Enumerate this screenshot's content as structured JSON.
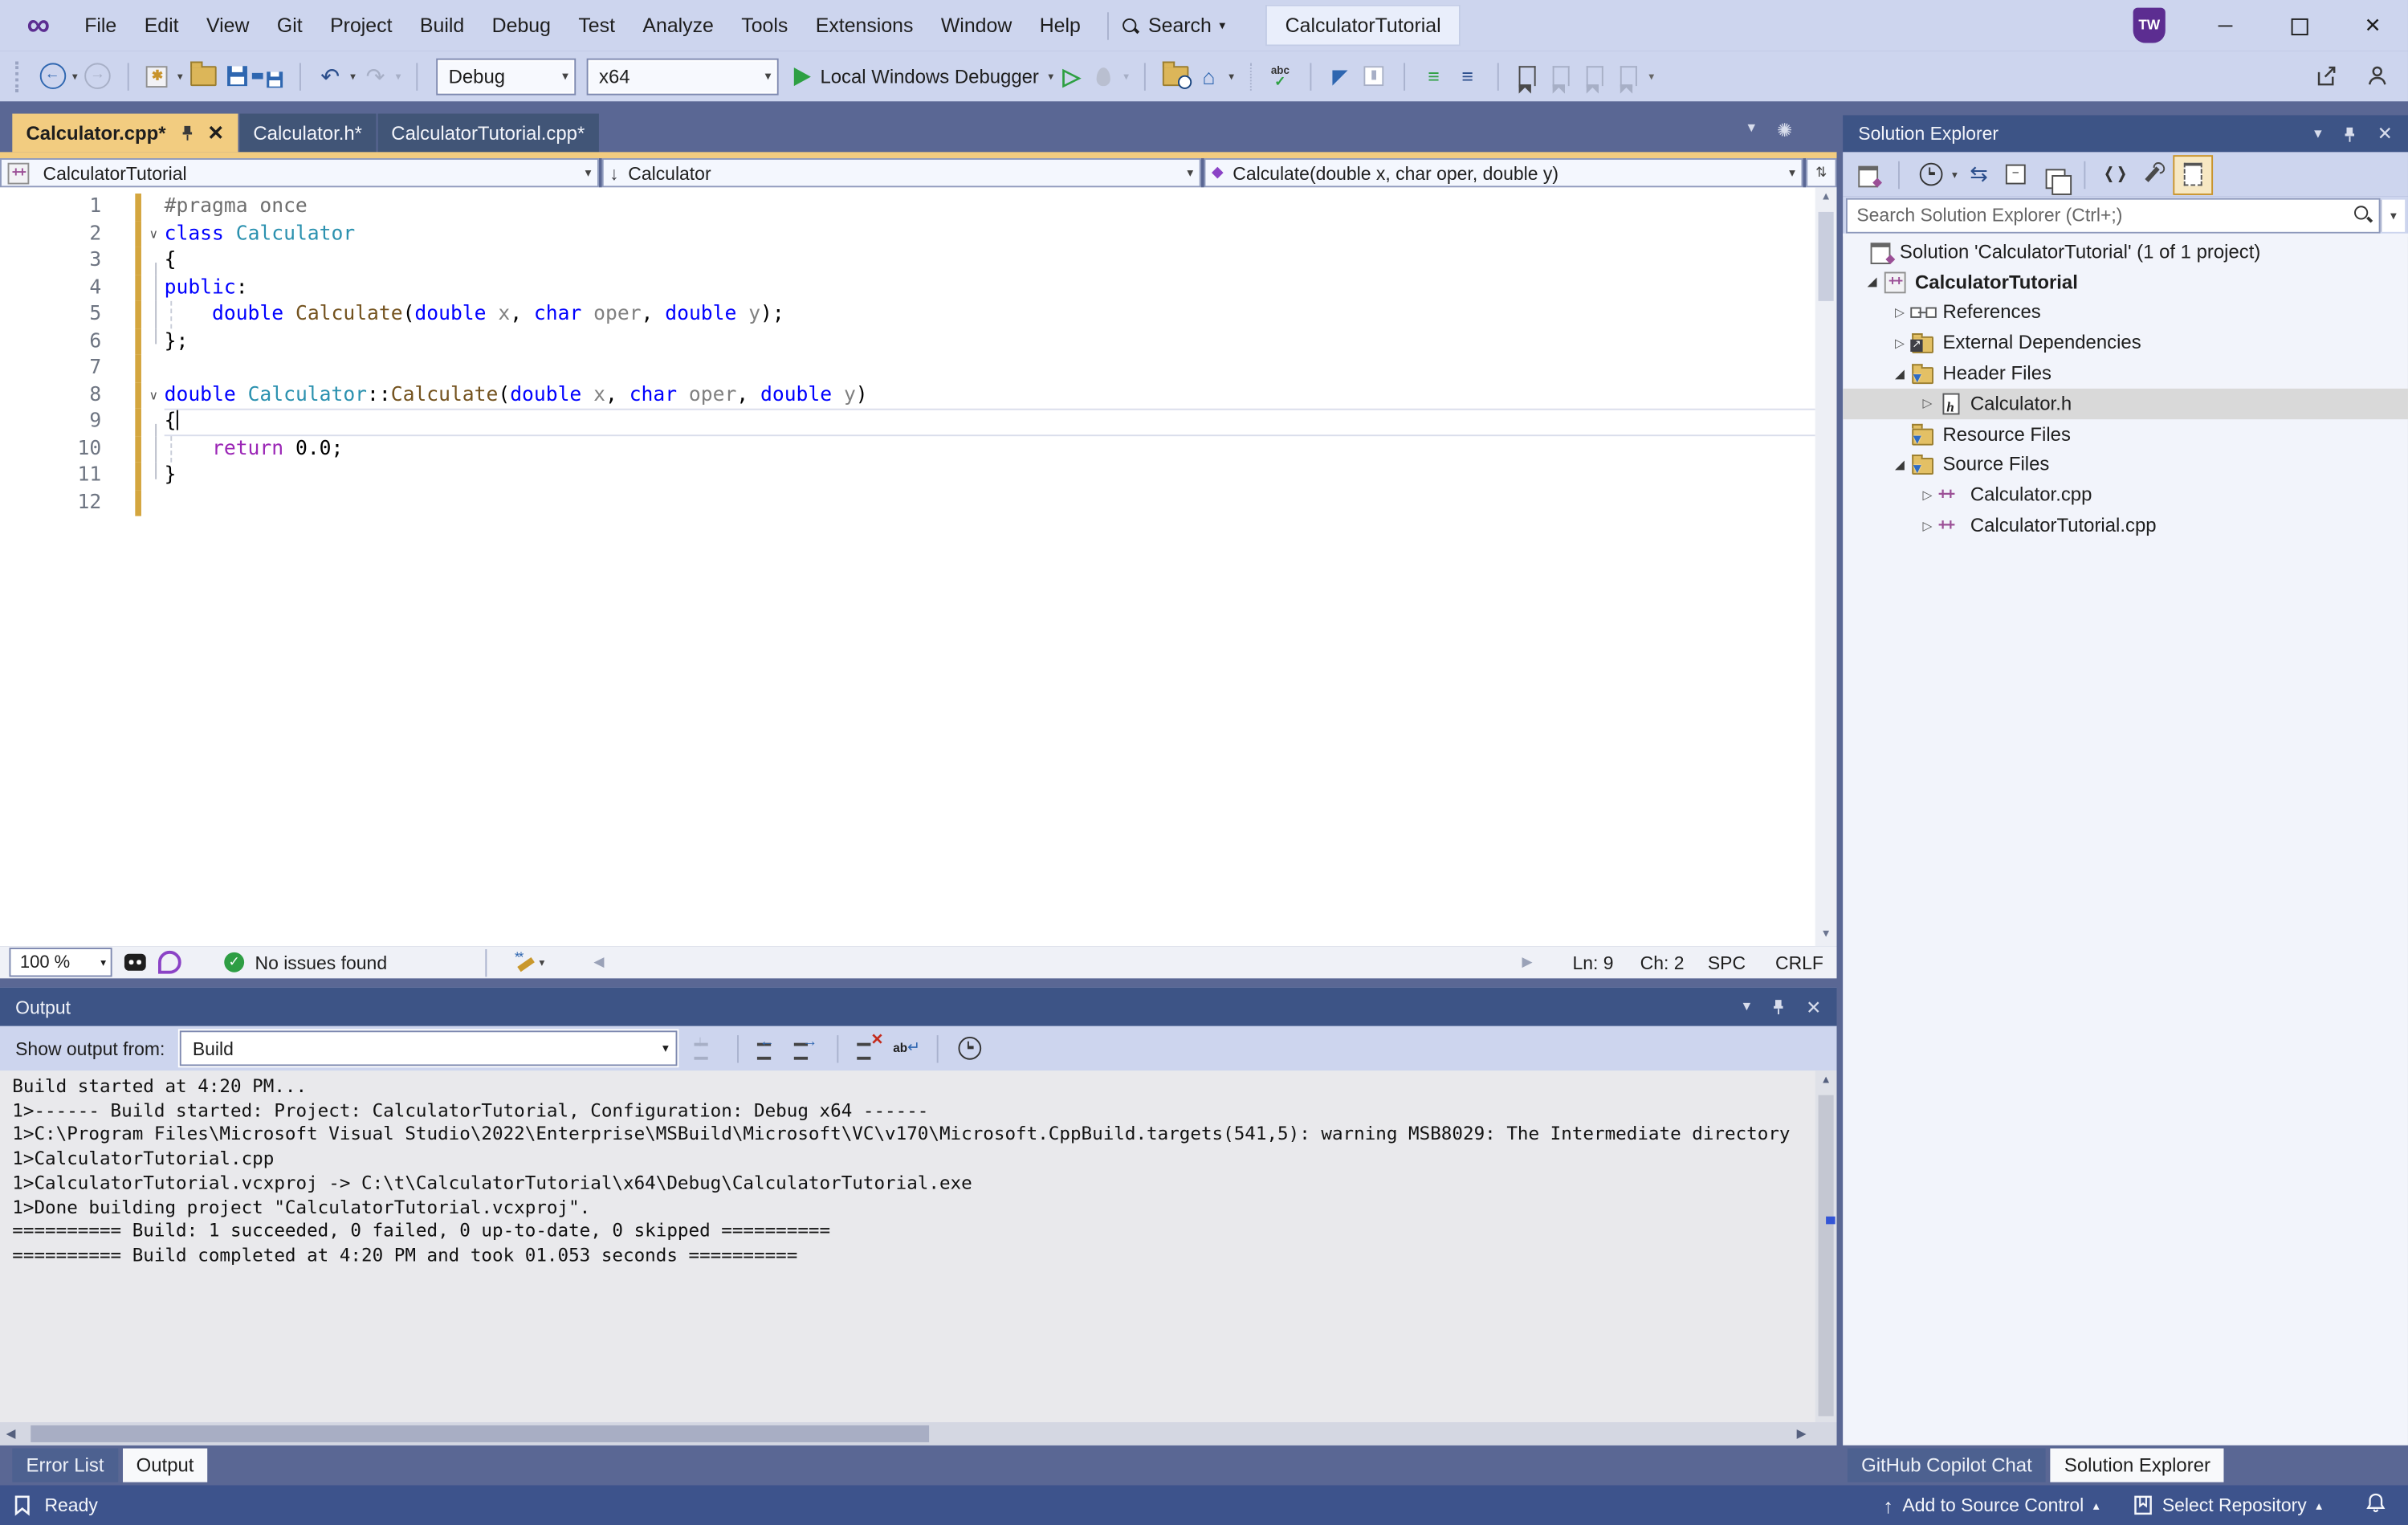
{
  "titlebar": {
    "menu_items": [
      "File",
      "Edit",
      "View",
      "Git",
      "Project",
      "Build",
      "Debug",
      "Test",
      "Analyze",
      "Tools",
      "Extensions",
      "Window",
      "Help"
    ],
    "search_label": "Search",
    "solution_box": "CalculatorTutorial",
    "avatar": "TW"
  },
  "toolbar": {
    "config": "Debug",
    "platform": "x64",
    "debug_target": "Local Windows Debugger"
  },
  "editor_tabs": [
    {
      "label": "Calculator.cpp*",
      "active": true
    },
    {
      "label": "Calculator.h*",
      "active": false
    },
    {
      "label": "CalculatorTutorial.cpp*",
      "active": false
    }
  ],
  "navbar": {
    "scope": "CalculatorTutorial",
    "type": "Calculator",
    "member": "Calculate(double x, char oper, double y)"
  },
  "code": {
    "lines": [
      {
        "n": 1,
        "tokens": [
          [
            "#pragma once",
            "pp"
          ]
        ]
      },
      {
        "n": 2,
        "fold": true,
        "tokens": [
          [
            "class",
            "kw"
          ],
          [
            " ",
            "pl"
          ],
          [
            "Calculator",
            "ty"
          ]
        ]
      },
      {
        "n": 3,
        "bracket": "low",
        "tokens": [
          [
            "{",
            "pl"
          ]
        ]
      },
      {
        "n": 4,
        "bracket": "full",
        "tokens": [
          [
            "public",
            "kw"
          ],
          [
            ":",
            "pl"
          ]
        ]
      },
      {
        "n": 5,
        "bracket": "full",
        "guide": true,
        "tokens": [
          [
            "    ",
            "pl"
          ],
          [
            "double",
            "kw"
          ],
          [
            " ",
            "pl"
          ],
          [
            "Calculate",
            "fn"
          ],
          [
            "(",
            "pl"
          ],
          [
            "double",
            "kw"
          ],
          [
            " ",
            "pl"
          ],
          [
            "x",
            "pm"
          ],
          [
            ", ",
            "pl"
          ],
          [
            "char",
            "kw"
          ],
          [
            " ",
            "pl"
          ],
          [
            "oper",
            "pm"
          ],
          [
            ", ",
            "pl"
          ],
          [
            "double",
            "kw"
          ],
          [
            " ",
            "pl"
          ],
          [
            "y",
            "pm"
          ],
          [
            ");",
            "pl"
          ]
        ]
      },
      {
        "n": 6,
        "bracket": "up",
        "tokens": [
          [
            "};",
            "pl"
          ]
        ]
      },
      {
        "n": 7,
        "tokens": []
      },
      {
        "n": 8,
        "fold": true,
        "tokens": [
          [
            "double",
            "kw"
          ],
          [
            " ",
            "pl"
          ],
          [
            "Calculator",
            "ty"
          ],
          [
            "::",
            "pl"
          ],
          [
            "Calculate",
            "fn"
          ],
          [
            "(",
            "pl"
          ],
          [
            "double",
            "kw"
          ],
          [
            " ",
            "pl"
          ],
          [
            "x",
            "pm"
          ],
          [
            ", ",
            "pl"
          ],
          [
            "char",
            "kw"
          ],
          [
            " ",
            "pl"
          ],
          [
            "oper",
            "pm"
          ],
          [
            ", ",
            "pl"
          ],
          [
            "double",
            "kw"
          ],
          [
            " ",
            "pl"
          ],
          [
            "y",
            "pm"
          ],
          [
            ")",
            "pl"
          ]
        ]
      },
      {
        "n": 9,
        "cur": true,
        "caret": true,
        "bracket": "low",
        "tokens": [
          [
            "{",
            "pl"
          ]
        ]
      },
      {
        "n": 10,
        "bracket": "full",
        "guide": true,
        "tokens": [
          [
            "    ",
            "pl"
          ],
          [
            "return",
            "ctl"
          ],
          [
            " ",
            "pl"
          ],
          [
            "0.0",
            "num"
          ],
          [
            ";",
            "pl"
          ]
        ]
      },
      {
        "n": 11,
        "bracket": "up",
        "tokens": [
          [
            "}",
            "pl"
          ]
        ]
      },
      {
        "n": 12,
        "tokens": []
      }
    ]
  },
  "editor_status": {
    "zoom": "100 %",
    "issues": "No issues found",
    "ln": "Ln: 9",
    "ch": "Ch: 2",
    "spc": "SPC",
    "eol": "CRLF"
  },
  "output": {
    "title": "Output",
    "show_output_from_label": "Show output from:",
    "source": "Build",
    "lines": [
      "Build started at 4:20 PM...",
      "1>------ Build started: Project: CalculatorTutorial, Configuration: Debug x64 ------",
      "1>C:\\Program Files\\Microsoft Visual Studio\\2022\\Enterprise\\MSBuild\\Microsoft\\VC\\v170\\Microsoft.CppBuild.targets(541,5): warning MSB8029: The Intermediate directory",
      "1>CalculatorTutorial.cpp",
      "1>CalculatorTutorial.vcxproj -> C:\\t\\CalculatorTutorial\\x64\\Debug\\CalculatorTutorial.exe",
      "1>Done building project \"CalculatorTutorial.vcxproj\".",
      "========== Build: 1 succeeded, 0 failed, 0 up-to-date, 0 skipped ==========",
      "========== Build completed at 4:20 PM and took 01.053 seconds =========="
    ]
  },
  "solution_explorer": {
    "title": "Solution Explorer",
    "search_placeholder": "Search Solution Explorer (Ctrl+;)",
    "tree": [
      {
        "label": "Solution 'CalculatorTutorial' (1 of 1 project)",
        "icon": "solution",
        "level": 0,
        "arrow": "none",
        "bold": false,
        "selected": false
      },
      {
        "label": "CalculatorTutorial",
        "icon": "cpp-project",
        "level": 1,
        "arrow": "expanded",
        "bold": true,
        "selected": false
      },
      {
        "label": "References",
        "icon": "references",
        "level": 2,
        "arrow": "collapsed",
        "bold": false,
        "selected": false
      },
      {
        "label": "External Dependencies",
        "icon": "external-deps",
        "level": 2,
        "arrow": "collapsed",
        "bold": false,
        "selected": false
      },
      {
        "label": "Header Files",
        "icon": "filter-folder",
        "level": 2,
        "arrow": "expanded",
        "bold": false,
        "selected": false
      },
      {
        "label": "Calculator.h",
        "icon": "header-file",
        "level": 3,
        "arrow": "collapsed",
        "bold": false,
        "selected": true
      },
      {
        "label": "Resource Files",
        "icon": "filter-folder",
        "level": 2,
        "arrow": "none",
        "bold": false,
        "selected": false
      },
      {
        "label": "Source Files",
        "icon": "filter-folder",
        "level": 2,
        "arrow": "expanded",
        "bold": false,
        "selected": false
      },
      {
        "label": "Calculator.cpp",
        "icon": "cpp-file",
        "level": 3,
        "arrow": "collapsed",
        "bold": false,
        "selected": false
      },
      {
        "label": "CalculatorTutorial.cpp",
        "icon": "cpp-file",
        "level": 3,
        "arrow": "collapsed",
        "bold": false,
        "selected": false
      }
    ]
  },
  "bottom_tabs": {
    "left": [
      {
        "label": "Error List",
        "active": false
      },
      {
        "label": "Output",
        "active": true
      }
    ],
    "right": [
      {
        "label": "GitHub Copilot Chat",
        "active": false
      },
      {
        "label": "Solution Explorer",
        "active": true
      }
    ]
  },
  "statusbar": {
    "ready": "Ready",
    "add_to_source_control": "Add to Source Control",
    "select_repository": "Select Repository"
  },
  "colors": {
    "chrome": "#CDD5EE",
    "frame": "#5A6794",
    "active_tab_gold": "#F2CC80",
    "panel_header": "#3D5486",
    "statusbar_blue": "#3D538C",
    "keyword_blue": "#0000FF",
    "type_teal": "#2B91AF",
    "function_brown": "#74531F",
    "control_purple": "#9B26B6"
  }
}
